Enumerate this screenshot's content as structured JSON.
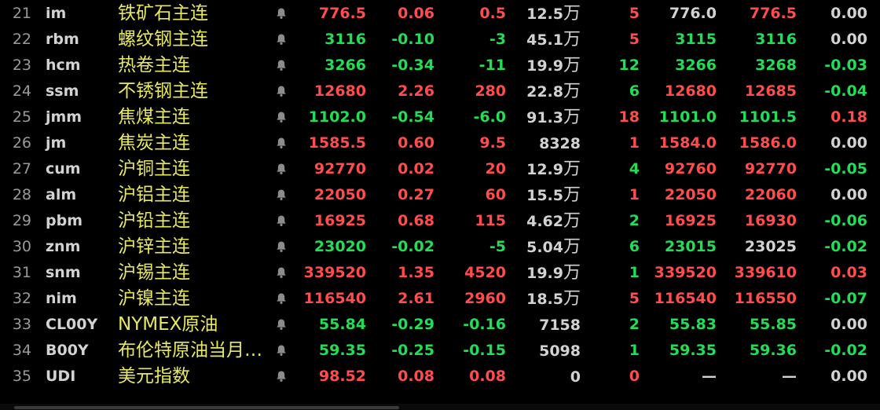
{
  "colors": {
    "up": "#ff4d4d",
    "down": "#22dd55",
    "flat": "#d2d2d2",
    "name": "#e8e860",
    "background": "#000000"
  },
  "alert_icon": "bell-icon",
  "rows": [
    {
      "idx": "21",
      "code": "im",
      "name": "铁矿石主连",
      "last": "776.5",
      "chg_pct": "0.06",
      "chg": "0.5",
      "vol_num": "12.5",
      "vol_unit": "万",
      "cur": "5",
      "bid": "776.0",
      "ask": "776.5",
      "spread": "0.00",
      "c": {
        "last": "up",
        "chg_pct": "up",
        "chg": "up",
        "cur": "up",
        "bid": "flat",
        "ask": "up",
        "spread": "flat"
      }
    },
    {
      "idx": "22",
      "code": "rbm",
      "name": "螺纹钢主连",
      "last": "3116",
      "chg_pct": "-0.10",
      "chg": "-3",
      "vol_num": "45.1",
      "vol_unit": "万",
      "cur": "5",
      "bid": "3115",
      "ask": "3116",
      "spread": "0.00",
      "c": {
        "last": "down",
        "chg_pct": "down",
        "chg": "down",
        "cur": "up",
        "bid": "down",
        "ask": "down",
        "spread": "flat"
      }
    },
    {
      "idx": "23",
      "code": "hcm",
      "name": "热卷主连",
      "last": "3266",
      "chg_pct": "-0.34",
      "chg": "-11",
      "vol_num": "19.9",
      "vol_unit": "万",
      "cur": "12",
      "bid": "3266",
      "ask": "3268",
      "spread": "-0.03",
      "c": {
        "last": "down",
        "chg_pct": "down",
        "chg": "down",
        "cur": "down",
        "bid": "down",
        "ask": "down",
        "spread": "down"
      }
    },
    {
      "idx": "24",
      "code": "ssm",
      "name": "不锈钢主连",
      "last": "12680",
      "chg_pct": "2.26",
      "chg": "280",
      "vol_num": "22.8",
      "vol_unit": "万",
      "cur": "6",
      "bid": "12680",
      "ask": "12685",
      "spread": "-0.04",
      "c": {
        "last": "up",
        "chg_pct": "up",
        "chg": "up",
        "cur": "down",
        "bid": "up",
        "ask": "up",
        "spread": "down"
      }
    },
    {
      "idx": "25",
      "code": "jmm",
      "name": "焦煤主连",
      "last": "1102.0",
      "chg_pct": "-0.54",
      "chg": "-6.0",
      "vol_num": "91.3",
      "vol_unit": "万",
      "cur": "18",
      "bid": "1101.0",
      "ask": "1101.5",
      "spread": "0.18",
      "c": {
        "last": "down",
        "chg_pct": "down",
        "chg": "down",
        "cur": "up",
        "bid": "down",
        "ask": "down",
        "spread": "up"
      }
    },
    {
      "idx": "26",
      "code": "jm",
      "name": "焦炭主连",
      "last": "1585.5",
      "chg_pct": "0.60",
      "chg": "9.5",
      "vol_num": "8328",
      "vol_unit": "",
      "cur": "1",
      "bid": "1584.0",
      "ask": "1586.0",
      "spread": "0.00",
      "c": {
        "last": "up",
        "chg_pct": "up",
        "chg": "up",
        "cur": "up",
        "bid": "up",
        "ask": "up",
        "spread": "flat"
      }
    },
    {
      "idx": "27",
      "code": "cum",
      "name": "沪铜主连",
      "last": "92770",
      "chg_pct": "0.02",
      "chg": "20",
      "vol_num": "12.9",
      "vol_unit": "万",
      "cur": "4",
      "bid": "92760",
      "ask": "92770",
      "spread": "-0.05",
      "c": {
        "last": "up",
        "chg_pct": "up",
        "chg": "up",
        "cur": "down",
        "bid": "up",
        "ask": "up",
        "spread": "down"
      }
    },
    {
      "idx": "28",
      "code": "alm",
      "name": "沪铝主连",
      "last": "22050",
      "chg_pct": "0.27",
      "chg": "60",
      "vol_num": "15.5",
      "vol_unit": "万",
      "cur": "1",
      "bid": "22050",
      "ask": "22060",
      "spread": "0.00",
      "c": {
        "last": "up",
        "chg_pct": "up",
        "chg": "up",
        "cur": "up",
        "bid": "up",
        "ask": "up",
        "spread": "flat"
      }
    },
    {
      "idx": "29",
      "code": "pbm",
      "name": "沪铅主连",
      "last": "16925",
      "chg_pct": "0.68",
      "chg": "115",
      "vol_num": "4.62",
      "vol_unit": "万",
      "cur": "2",
      "bid": "16925",
      "ask": "16930",
      "spread": "-0.06",
      "c": {
        "last": "up",
        "chg_pct": "up",
        "chg": "up",
        "cur": "down",
        "bid": "up",
        "ask": "up",
        "spread": "down"
      }
    },
    {
      "idx": "30",
      "code": "znm",
      "name": "沪锌主连",
      "last": "23020",
      "chg_pct": "-0.02",
      "chg": "-5",
      "vol_num": "5.04",
      "vol_unit": "万",
      "cur": "6",
      "bid": "23015",
      "ask": "23025",
      "spread": "-0.02",
      "c": {
        "last": "down",
        "chg_pct": "down",
        "chg": "down",
        "cur": "down",
        "bid": "down",
        "ask": "flat",
        "spread": "down"
      }
    },
    {
      "idx": "31",
      "code": "snm",
      "name": "沪锡主连",
      "last": "339520",
      "chg_pct": "1.35",
      "chg": "4520",
      "vol_num": "19.9",
      "vol_unit": "万",
      "cur": "1",
      "bid": "339520",
      "ask": "339610",
      "spread": "0.03",
      "c": {
        "last": "up",
        "chg_pct": "up",
        "chg": "up",
        "cur": "down",
        "bid": "up",
        "ask": "up",
        "spread": "up"
      }
    },
    {
      "idx": "32",
      "code": "nim",
      "name": "沪镍主连",
      "last": "116540",
      "chg_pct": "2.61",
      "chg": "2960",
      "vol_num": "18.5",
      "vol_unit": "万",
      "cur": "5",
      "bid": "116540",
      "ask": "116550",
      "spread": "-0.07",
      "c": {
        "last": "up",
        "chg_pct": "up",
        "chg": "up",
        "cur": "up",
        "bid": "up",
        "ask": "up",
        "spread": "down"
      }
    },
    {
      "idx": "33",
      "code": "CL00Y",
      "name": "NYMEX原油",
      "last": "55.84",
      "chg_pct": "-0.29",
      "chg": "-0.16",
      "vol_num": "7158",
      "vol_unit": "",
      "cur": "2",
      "bid": "55.83",
      "ask": "55.85",
      "spread": "0.00",
      "c": {
        "last": "down",
        "chg_pct": "down",
        "chg": "down",
        "cur": "down",
        "bid": "down",
        "ask": "down",
        "spread": "flat"
      }
    },
    {
      "idx": "34",
      "code": "B00Y",
      "name": "布伦特原油当月…",
      "last": "59.35",
      "chg_pct": "-0.25",
      "chg": "-0.15",
      "vol_num": "5098",
      "vol_unit": "",
      "cur": "1",
      "bid": "59.35",
      "ask": "59.36",
      "spread": "-0.02",
      "c": {
        "last": "down",
        "chg_pct": "down",
        "chg": "down",
        "cur": "down",
        "bid": "down",
        "ask": "down",
        "spread": "down"
      }
    },
    {
      "idx": "35",
      "code": "UDI",
      "name": "美元指数",
      "last": "98.52",
      "chg_pct": "0.08",
      "chg": "0.08",
      "vol_num": "0",
      "vol_unit": "",
      "cur": "0",
      "bid": "—",
      "ask": "—",
      "spread": "0.00",
      "c": {
        "last": "up",
        "chg_pct": "up",
        "chg": "up",
        "cur": "up",
        "bid": "flat",
        "ask": "flat",
        "spread": "flat"
      }
    }
  ]
}
